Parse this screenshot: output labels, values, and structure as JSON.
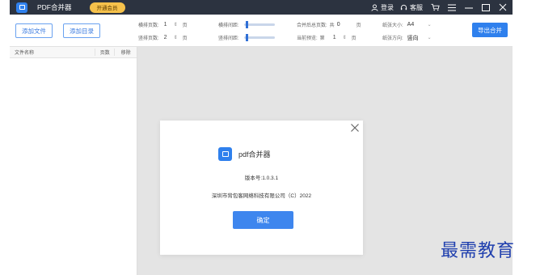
{
  "titlebar": {
    "app_title": "PDF合并器",
    "vip_label": "开通会员",
    "login_label": "登录",
    "service_label": "客服"
  },
  "toolbar": {
    "add_file_label": "添加文件",
    "add_dir_label": "添加目录",
    "h_pages_label": "横排页数:",
    "h_pages_value": "1",
    "v_pages_label": "竖排页数:",
    "v_pages_value": "2",
    "page_unit": "页",
    "h_spacing_label": "横排间距:",
    "v_spacing_label": "竖排间距:",
    "h_spacing_value": 0.05,
    "v_spacing_value": 0.05,
    "total_pages_label": "合并后总页数:",
    "total_pages_prefix": "共",
    "total_pages_value": "0",
    "current_preview_label": "当前预览:",
    "current_preview_prefix": "第",
    "current_preview_value": "1",
    "paper_size_label": "纸张大小:",
    "paper_size_value": "A4",
    "paper_dir_label": "纸张方向:",
    "paper_dir_value": "竖向",
    "export_label": "导出合并"
  },
  "filelist": {
    "col_name": "文件名称",
    "col_pages": "页数",
    "col_remove": "移除"
  },
  "dialog": {
    "app_name": "pdf合并器",
    "version": "版本号:1.0.3.1",
    "company": "深圳市背包客网络科技有限公司（C）2022",
    "ok_label": "确定"
  },
  "watermark": "最需教育",
  "colors": {
    "accent": "#2f80ed",
    "titlebar_bg": "#2c3340",
    "vip_bg": "#f5c14b"
  }
}
